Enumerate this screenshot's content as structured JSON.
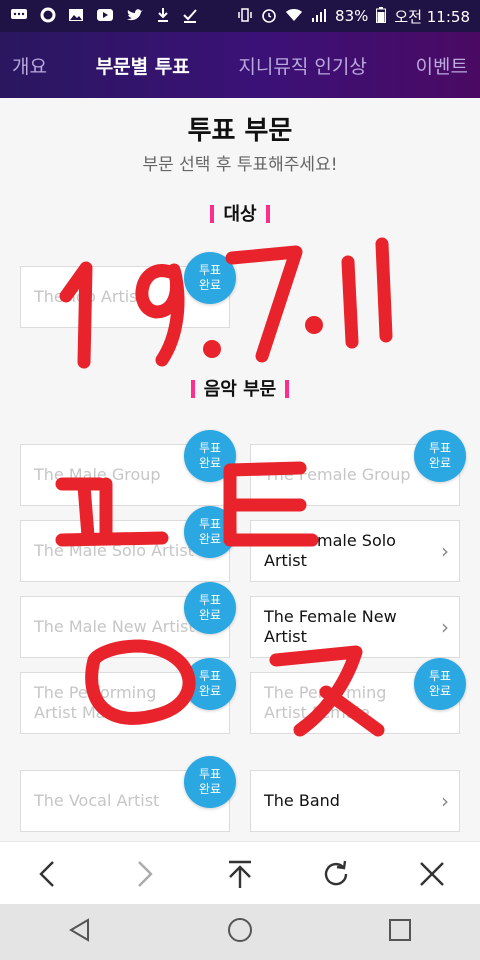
{
  "status_bar": {
    "battery": "83%",
    "time": "오전 11:58",
    "icons": [
      "message-icon",
      "circle-icon",
      "image-icon",
      "youtube-icon",
      "twitter-icon",
      "download-icon",
      "check-icon",
      "vibrate-icon",
      "alarm-icon",
      "wifi-icon",
      "signal-icon",
      "battery-icon"
    ]
  },
  "tabs": [
    {
      "label": "개요"
    },
    {
      "label": "부문별 투표"
    },
    {
      "label": "지니뮤직 인기상"
    },
    {
      "label": "이벤트"
    }
  ],
  "main": {
    "title": "투표 부문",
    "subtitle": "부문 선택 후 투표해주세요!",
    "badge_text": "투표\n완료",
    "sections": [
      {
        "heading": "대상",
        "cards": [
          {
            "label": "The Top Artist",
            "voted": true
          }
        ]
      },
      {
        "heading": "음악 부문",
        "cards": [
          {
            "label": "The Male Group",
            "voted": true
          },
          {
            "label": "The Female Group",
            "voted": true
          },
          {
            "label": "The Male Solo Artist",
            "voted": true
          },
          {
            "label": "The Female Solo Artist",
            "voted": false
          },
          {
            "label": "The Male New Artist",
            "voted": true
          },
          {
            "label": "The Female New Artist",
            "voted": false
          },
          {
            "label": "The Performing Artist Male",
            "voted": true
          },
          {
            "label": "The Performing Artist Female",
            "voted": true
          },
          {
            "label": "The Vocal Artist",
            "voted": true
          },
          {
            "label": "The Band",
            "voted": false
          }
        ]
      }
    ]
  },
  "handwriting": {
    "date": "19.7.11",
    "letters": "ㅍㅌㅇㅈ",
    "color": "#e8232b"
  },
  "toolbar": {
    "icons": [
      "back-icon",
      "forward-icon",
      "scroll-top-icon",
      "refresh-icon",
      "close-icon"
    ]
  },
  "navbar": {
    "icons": [
      "nav-back-icon",
      "nav-home-icon",
      "nav-recents-icon"
    ]
  },
  "colors": {
    "accent": "#2ba8e1",
    "section_bar": "#ff2e8a",
    "header": "#2a1760"
  }
}
